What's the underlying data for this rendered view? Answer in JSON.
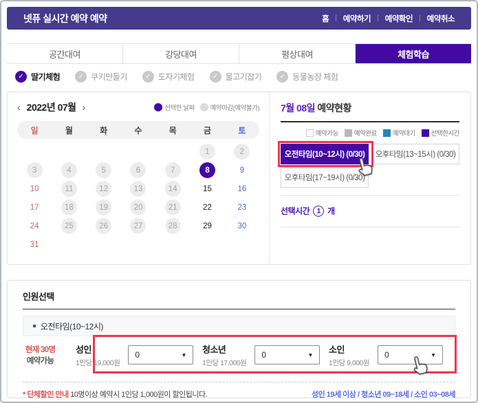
{
  "icons": {
    "check": "✓",
    "chevron_down": "▼",
    "prev": "‹",
    "next": "›",
    "pipe": "|"
  },
  "colors": {
    "header_bg": "#463a8c",
    "accent_purple": "#420aa3",
    "annotation_red": "#ee3550",
    "sunday_red": "#cf6459",
    "saturday_blue": "#4f68d8",
    "waiting_blue": "#1f86b8",
    "done_gray": "#b8b8b8",
    "info_blue": "#5b6be0",
    "warn_red": "#e05252"
  },
  "header": {
    "title": "넷퓨 실시간 예약 예약",
    "nav": [
      {
        "label": "홈"
      },
      {
        "label": "예약하기"
      },
      {
        "label": "예약확인"
      },
      {
        "label": "예약취소"
      }
    ]
  },
  "tabs": [
    {
      "label": "공간대여"
    },
    {
      "label": "강당대여"
    },
    {
      "label": "평상대여"
    },
    {
      "label": "체험학습"
    }
  ],
  "experience_options": [
    {
      "label": "딸기체험"
    },
    {
      "label": "쿠키만들기"
    },
    {
      "label": "도자기체험"
    },
    {
      "label": "물고기잡기"
    },
    {
      "label": "동물농장 체험"
    }
  ],
  "calendar": {
    "title": "2022년 07월",
    "legend": [
      {
        "label": "선택한 날짜"
      },
      {
        "label": "예약마감(예약불가)"
      }
    ],
    "weekdays": [
      "일",
      "월",
      "화",
      "수",
      "목",
      "금",
      "토"
    ],
    "weeks": [
      [
        {
          "day": "",
          "state": "empty"
        },
        {
          "day": "",
          "state": "empty"
        },
        {
          "day": "",
          "state": "empty"
        },
        {
          "day": "",
          "state": "empty"
        },
        {
          "day": "",
          "state": "empty"
        },
        {
          "day": "1",
          "state": "disabled"
        },
        {
          "day": "2",
          "state": "disabled"
        }
      ],
      [
        {
          "day": "3",
          "state": "disabled"
        },
        {
          "day": "4",
          "state": "disabled"
        },
        {
          "day": "5",
          "state": "disabled"
        },
        {
          "day": "6",
          "state": "disabled"
        },
        {
          "day": "7",
          "state": "disabled"
        },
        {
          "day": "8",
          "state": "selected"
        },
        {
          "day": "9",
          "state": "sat"
        }
      ],
      [
        {
          "day": "10",
          "state": "sun"
        },
        {
          "day": "11",
          "state": "disabled"
        },
        {
          "day": "12",
          "state": "disabled"
        },
        {
          "day": "13",
          "state": "disabled"
        },
        {
          "day": "14",
          "state": "disabled"
        },
        {
          "day": "15",
          "state": "normal"
        },
        {
          "day": "16",
          "state": "sat"
        }
      ],
      [
        {
          "day": "17",
          "state": "sun"
        },
        {
          "day": "18",
          "state": "disabled"
        },
        {
          "day": "19",
          "state": "disabled"
        },
        {
          "day": "20",
          "state": "disabled"
        },
        {
          "day": "21",
          "state": "disabled"
        },
        {
          "day": "22",
          "state": "normal"
        },
        {
          "day": "23",
          "state": "sat"
        }
      ],
      [
        {
          "day": "24",
          "state": "sun"
        },
        {
          "day": "25",
          "state": "disabled"
        },
        {
          "day": "26",
          "state": "disabled"
        },
        {
          "day": "27",
          "state": "disabled"
        },
        {
          "day": "28",
          "state": "disabled"
        },
        {
          "day": "29",
          "state": "normal"
        },
        {
          "day": "30",
          "state": "sat"
        }
      ],
      [
        {
          "day": "31",
          "state": "sun"
        },
        {
          "day": "",
          "state": "empty"
        },
        {
          "day": "",
          "state": "empty"
        },
        {
          "day": "",
          "state": "empty"
        },
        {
          "day": "",
          "state": "empty"
        },
        {
          "day": "",
          "state": "empty"
        },
        {
          "day": "",
          "state": "empty"
        }
      ]
    ]
  },
  "status_panel": {
    "date": "7월 08일",
    "title": " 예약현황",
    "legend": [
      {
        "label": "예약가능"
      },
      {
        "label": "예약완료"
      },
      {
        "label": "예약대기"
      },
      {
        "label": "선택한시간"
      }
    ],
    "slots": [
      {
        "label": "오전타임(10~12시) (0/30)",
        "state": "selected"
      },
      {
        "label": "오후타임(13~15시) (0/30)",
        "state": "available"
      },
      {
        "label": "오후타임(17~19시) (0/30)",
        "state": "available"
      }
    ],
    "selected_time": {
      "label": "선택시간",
      "count": "1",
      "unit": "개"
    }
  },
  "people": {
    "title": "인원선택",
    "slot": "오전타임(10~12시)",
    "availability": {
      "highlight": "현재 30명",
      "rest": " 예약가능"
    },
    "groups": [
      {
        "name": "성인",
        "price": "1인당 19,000원",
        "value": "0"
      },
      {
        "name": "청소년",
        "price": "1인당 17,000원",
        "value": "0"
      },
      {
        "name": "소인",
        "price": "1인당 9,000원",
        "value": "0"
      }
    ],
    "discount": {
      "highlight": "* 단체할인 안내",
      "rest": "  10명이상 예약시 1인당 1,000원이 할인됩니다."
    },
    "ages": "성인 19세 이상 / 청소년 09~18세 / 소인 03~08세"
  }
}
